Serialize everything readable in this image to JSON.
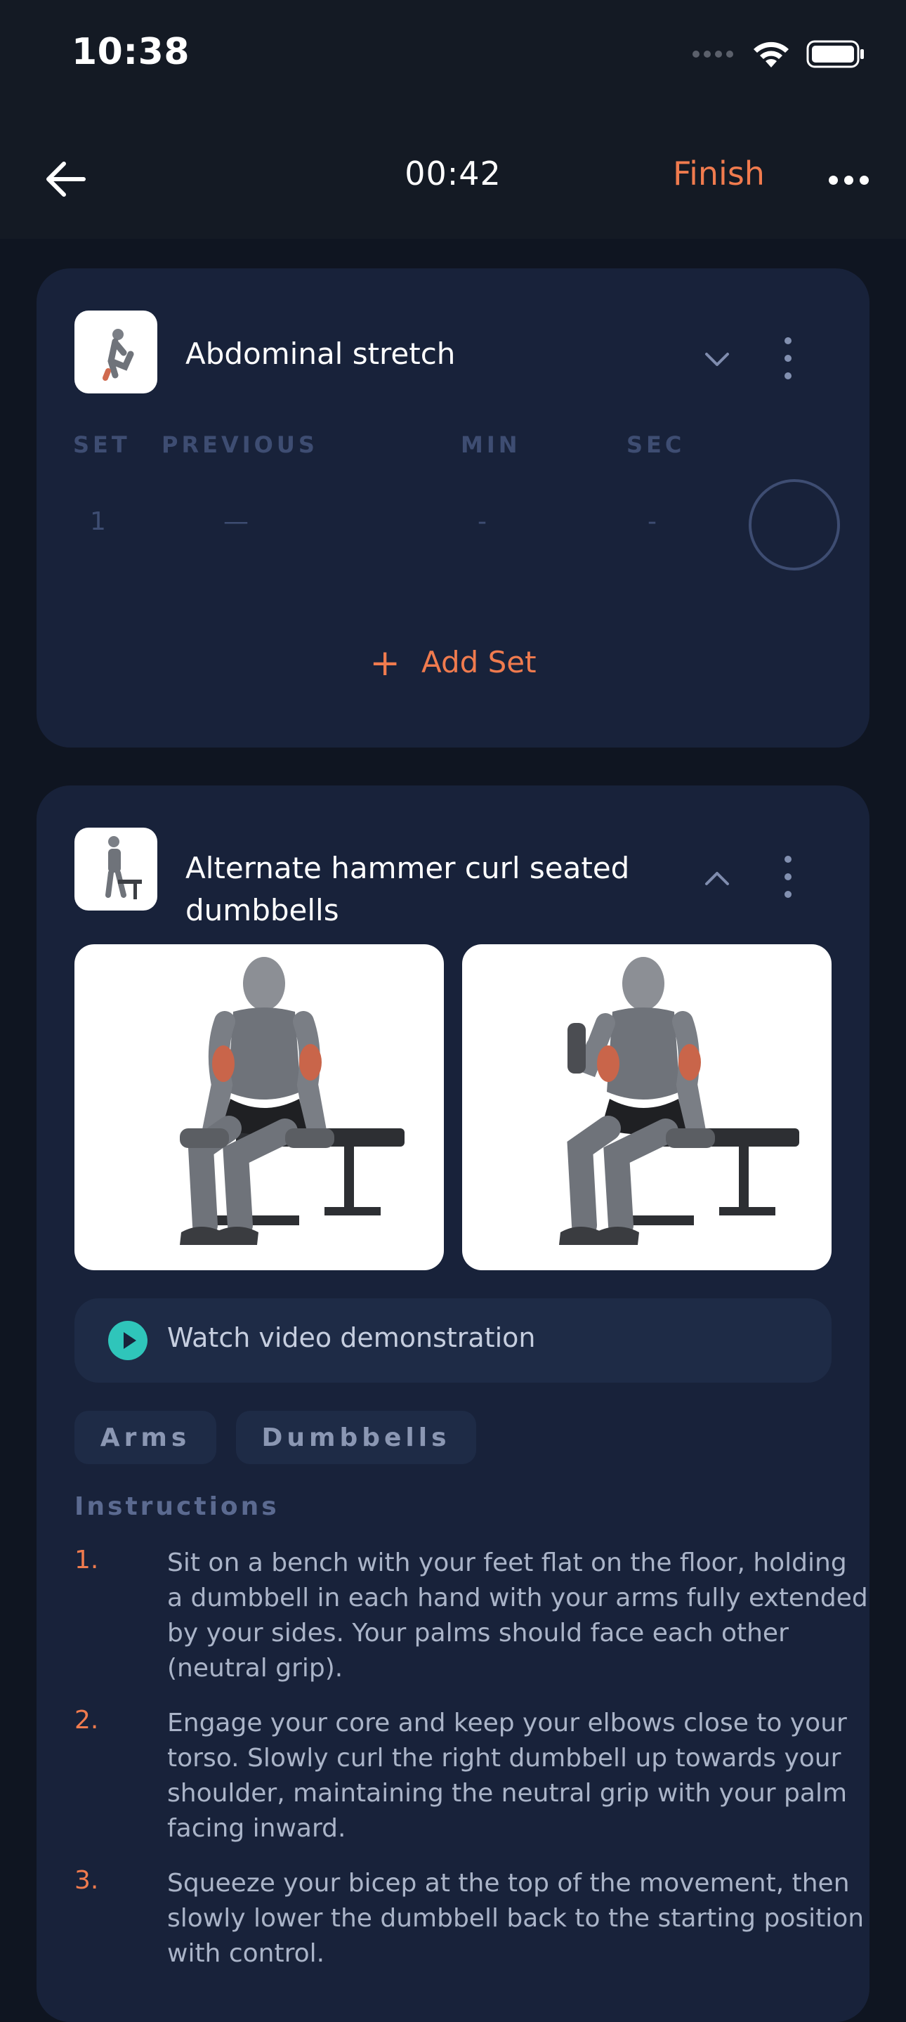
{
  "status": {
    "time": "10:38"
  },
  "nav": {
    "timer": "00:42",
    "finish_label": "Finish"
  },
  "exercise1": {
    "title": "Abdominal stretch",
    "columns": [
      "SET",
      "PREVIOUS",
      "MIN",
      "SEC"
    ],
    "row": {
      "set": "1",
      "previous": "—",
      "min": "-",
      "sec": "-"
    },
    "add_set_label": "Add Set"
  },
  "exercise2": {
    "title_line1": "Alternate hammer curl seated",
    "title_line2": "dumbbells",
    "video_label": "Watch video demonstration",
    "tags": [
      "Arms",
      "Dumbbells"
    ],
    "instructions_title": "Instructions",
    "steps": [
      {
        "num": "1.",
        "text": "Sit on a bench with your feet flat on the floor, holding a dumbbell in each hand with your arms fully extended by your sides. Your palms should face each other (neutral grip)."
      },
      {
        "num": "2.",
        "text": "Engage your core and keep your elbows close to your torso. Slowly curl the right dumbbell up towards your shoulder, maintaining the neutral grip with your palm facing inward."
      },
      {
        "num": "3.",
        "text": "Squeeze your bicep at the top of the movement, then slowly lower the dumbbell back to the starting position with control."
      }
    ]
  },
  "colors": {
    "accent": "#f07b4e",
    "card": "#18223a",
    "background": "#0f1521",
    "play": "#2fc5ba"
  }
}
